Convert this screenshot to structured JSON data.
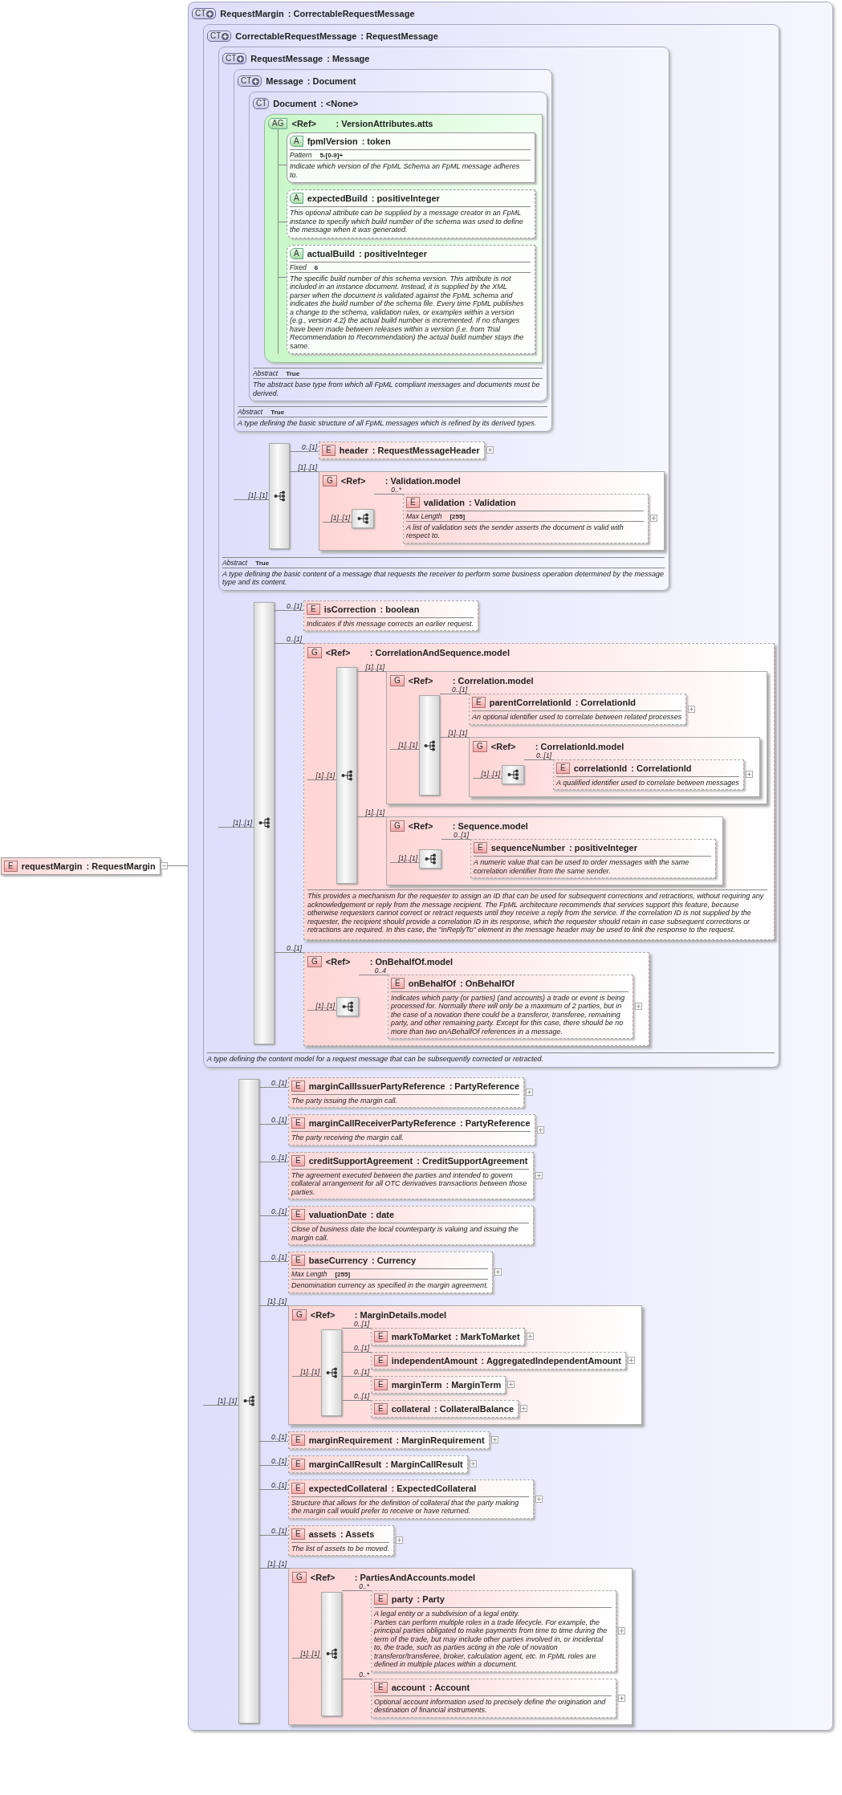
{
  "root_element": {
    "kind": "element",
    "badge": "E",
    "name": "requestMargin",
    "type": ": RequestMargin",
    "optional": false,
    "expanded": true
  },
  "type_tree": {
    "kind": "complex_type",
    "badge": "CT",
    "derived": true,
    "name": "RequestMargin",
    "type": ": CorrectableRequestMessage",
    "base": {
      "kind": "complex_type",
      "badge": "CT",
      "derived": true,
      "name": "CorrectableRequestMessage",
      "type": ": RequestMessage",
      "base": {
        "kind": "complex_type",
        "badge": "CT",
        "derived": true,
        "name": "RequestMessage",
        "type": ": Message",
        "base": {
          "kind": "complex_type",
          "badge": "CT",
          "derived": true,
          "name": "Message",
          "type": ": Document",
          "base": {
            "kind": "complex_type",
            "badge": "CT",
            "derived": false,
            "name": "Document",
            "type": ": <None>",
            "attributes": {
              "kind": "attribute_group",
              "badge": "AG",
              "name": "<Ref>",
              "type": ": VersionAttributes.atts",
              "items": [
                {
                  "kind": "attribute",
                  "badge": "A",
                  "name": "fpmlVersion",
                  "type": ": token",
                  "optional": false,
                  "facets": [
                    {
                      "label": "Pattern",
                      "value": "5-[0-9]+"
                    }
                  ],
                  "documentation": "Indicate which version of the FpML Schema an FpML message adheres to."
                },
                {
                  "kind": "attribute",
                  "badge": "A",
                  "name": "expectedBuild",
                  "type": ": positiveInteger",
                  "optional": true,
                  "documentation": "This optional attribute can be supplied by a message creator in an FpML instance to specify which build number of the schema was used to define the message when it was generated."
                },
                {
                  "kind": "attribute",
                  "badge": "A",
                  "name": "actualBuild",
                  "type": ": positiveInteger",
                  "optional": true,
                  "facets": [
                    {
                      "label": "Fixed",
                      "value": "6"
                    }
                  ],
                  "documentation": "The specific build number of this schema version. This attribute is not included in an instance document. Instead, it is supplied by the XML parser when the document is validated against the FpML schema and indicates the build number of the schema file. Every time FpML publishes a change to the schema, validation rules, or examples within a version (e.g., version 4.2) the actual build number is incremented. If no changes have been made between releases within a version (i.e. from Trial Recommendation to Recommendation) the actual build number stays the same."
                }
              ]
            },
            "facets": [
              {
                "label": "Abstract",
                "value": "True"
              }
            ],
            "documentation": "The abstract base type from which all FpML compliant messages and documents must be derived."
          },
          "facets": [
            {
              "label": "Abstract",
              "value": "True"
            }
          ],
          "documentation": "A type defining the basic structure of all FpML messages which is refined by its derived types."
        },
        "sequence": {
          "occurs": "[1]..[1]",
          "items": [
            {
              "kind": "element",
              "badge": "E",
              "name": "header",
              "type": ": RequestMessageHeader",
              "occurs": "0..[1]",
              "optional": true,
              "expandable": true
            },
            {
              "kind": "group",
              "badge": "G",
              "name": "<Ref>",
              "type": ": Validation.model",
              "occurs": "[1]..[1]",
              "optional": false,
              "sequence": {
                "occurs": "[1]..[1]",
                "items": [
                  {
                    "kind": "element",
                    "badge": "E",
                    "name": "validation",
                    "type": ": Validation",
                    "occurs": "0..*",
                    "optional": true,
                    "expandable": true,
                    "facets": [
                      {
                        "label": "Max Length",
                        "value": "[255]"
                      }
                    ],
                    "documentation": "A list of validation sets the sender asserts the document is valid with respect to."
                  }
                ]
              }
            }
          ]
        },
        "facets": [
          {
            "label": "Abstract",
            "value": "True"
          }
        ],
        "documentation": "A type defining the basic content of a message that requests the receiver to perform some business operation determined by the message type and its content."
      },
      "sequence": {
        "occurs": "[1]..[1]",
        "items": [
          {
            "kind": "element",
            "badge": "E",
            "name": "isCorrection",
            "type": ": boolean",
            "occurs": "0..[1]",
            "optional": true,
            "expandable": false,
            "documentation": "Indicates if this message corrects an earlier request."
          },
          {
            "kind": "group",
            "badge": "G",
            "name": "<Ref>",
            "type": ": CorrelationAndSequence.model",
            "occurs": "0..[1]",
            "optional": true,
            "sequence": {
              "occurs": "[1]..[1]",
              "items": [
                {
                  "kind": "group",
                  "badge": "G",
                  "name": "<Ref>",
                  "type": ": Correlation.model",
                  "occurs": "[1]..[1]",
                  "optional": false,
                  "sequence": {
                    "occurs": "[1]..[1]",
                    "items": [
                      {
                        "kind": "element",
                        "badge": "E",
                        "name": "parentCorrelationId",
                        "type": ": CorrelationId",
                        "occurs": "0..[1]",
                        "optional": true,
                        "expandable": true,
                        "documentation": "An optional identifier used to correlate between related processes"
                      },
                      {
                        "kind": "group",
                        "badge": "G",
                        "name": "<Ref>",
                        "type": ": CorrelationId.model",
                        "occurs": "[1]..[1]",
                        "optional": false,
                        "sequence": {
                          "occurs": "[1]..[1]",
                          "items": [
                            {
                              "kind": "element",
                              "badge": "E",
                              "name": "correlationId",
                              "type": ": CorrelationId",
                              "occurs": "0..[1]",
                              "optional": true,
                              "expandable": true,
                              "documentation": "A qualified identifier used to correlate between messages"
                            }
                          ]
                        }
                      }
                    ]
                  }
                },
                {
                  "kind": "group",
                  "badge": "G",
                  "name": "<Ref>",
                  "type": ": Sequence.model",
                  "occurs": "[1]..[1]",
                  "optional": false,
                  "sequence": {
                    "occurs": "[1]..[1]",
                    "items": [
                      {
                        "kind": "element",
                        "badge": "E",
                        "name": "sequenceNumber",
                        "type": ": positiveInteger",
                        "occurs": "0..[1]",
                        "optional": true,
                        "expandable": false,
                        "documentation": "A numeric value that can be used to order messages with the same correlation identifier from the same sender."
                      }
                    ]
                  }
                }
              ]
            },
            "documentation": "This provides a mechanism for the requester to assign an ID that can be used for subsequent corrections and retractions, without requiring any acknowledgement or reply from the message recipient. The FpML architecture recommends that services support this feature, because otherwise requesters cannot correct or retract requests until they receive a reply from the service. If the correlation ID is not supplied by the requester, the recipient should provide a correlation ID in its response, which the requester should retain in case subsequent corrections or retractions are required. In this case, the \"inReplyTo\" element in the message header may be used to link the response to the request."
          },
          {
            "kind": "group",
            "badge": "G",
            "name": "<Ref>",
            "type": ": OnBehalfOf.model",
            "occurs": "0..[1]",
            "optional": true,
            "sequence": {
              "occurs": "[1]..[1]",
              "items": [
                {
                  "kind": "element",
                  "badge": "E",
                  "name": "onBehalfOf",
                  "type": ": OnBehalfOf",
                  "occurs": "0..4",
                  "optional": true,
                  "expandable": true,
                  "documentation": "Indicates which party (or parties) (and accounts) a trade or event is being processed for. Normally there will only be a maximum of 2 parties, but in the case of a novation there could be a transferor, transferee, remaining party, and other remaining party. Except for this case, there should be no more than two onABehalfOf references in a message."
                }
              ]
            }
          }
        ]
      },
      "documentation": "A type defining the content model for a request message that can be subsequently corrected or retracted."
    },
    "sequence": {
      "occurs": "[1]..[1]",
      "items": [
        {
          "kind": "element",
          "badge": "E",
          "name": "marginCallIssuerPartyReference",
          "type": ": PartyReference",
          "occurs": "0..[1]",
          "optional": true,
          "expandable": true,
          "documentation": "The party issuing the margin call."
        },
        {
          "kind": "element",
          "badge": "E",
          "name": "marginCallReceiverPartyReference",
          "type": ": PartyReference",
          "occurs": "0..[1]",
          "optional": true,
          "expandable": true,
          "documentation": "The party receiving the margin call."
        },
        {
          "kind": "element",
          "badge": "E",
          "name": "creditSupportAgreement",
          "type": ": CreditSupportAgreement",
          "occurs": "0..[1]",
          "optional": true,
          "expandable": true,
          "documentation": "The agreement executed between the parties and intended to govern collateral arrangement for all OTC derivatives transactions between those parties."
        },
        {
          "kind": "element",
          "badge": "E",
          "name": "valuationDate",
          "type": ": date",
          "occurs": "0..[1]",
          "optional": true,
          "expandable": false,
          "documentation": "Close of business date the local counterparty is valuing and issuing the margin call."
        },
        {
          "kind": "element",
          "badge": "E",
          "name": "baseCurrency",
          "type": ": Currency",
          "occurs": "0..[1]",
          "optional": true,
          "expandable": true,
          "facets": [
            {
              "label": "Max Length",
              "value": "[255]"
            }
          ],
          "documentation": "Denomination currency as specified in the margin agreement."
        },
        {
          "kind": "group",
          "badge": "G",
          "name": "<Ref>",
          "type": ": MarginDetails.model",
          "occurs": "[1]..[1]",
          "optional": false,
          "sequence": {
            "occurs": "[1]..[1]",
            "items": [
              {
                "kind": "element",
                "badge": "E",
                "name": "markToMarket",
                "type": ": MarkToMarket",
                "occurs": "0..[1]",
                "optional": true,
                "expandable": true
              },
              {
                "kind": "element",
                "badge": "E",
                "name": "independentAmount",
                "type": ": AggregatedIndependentAmount",
                "occurs": "0..[1]",
                "optional": true,
                "expandable": true
              },
              {
                "kind": "element",
                "badge": "E",
                "name": "marginTerm",
                "type": ": MarginTerm",
                "occurs": "0..[1]",
                "optional": true,
                "expandable": true
              },
              {
                "kind": "element",
                "badge": "E",
                "name": "collateral",
                "type": ": CollateralBalance",
                "occurs": "0..[1]",
                "optional": true,
                "expandable": true
              }
            ]
          }
        },
        {
          "kind": "element",
          "badge": "E",
          "name": "marginRequirement",
          "type": ": MarginRequirement",
          "occurs": "0..[1]",
          "optional": true,
          "expandable": true
        },
        {
          "kind": "element",
          "badge": "E",
          "name": "marginCallResult",
          "type": ": MarginCallResult",
          "occurs": "0..[1]",
          "optional": true,
          "expandable": true
        },
        {
          "kind": "element",
          "badge": "E",
          "name": "expectedCollateral",
          "type": ": ExpectedCollateral",
          "occurs": "0..[1]",
          "optional": true,
          "expandable": true,
          "documentation": "Structure that allows for the definition of collateral that the party making the margin call would prefer to receive or have returned."
        },
        {
          "kind": "element",
          "badge": "E",
          "name": "assets",
          "type": ": Assets",
          "occurs": "0..[1]",
          "optional": true,
          "expandable": true,
          "documentation": "The list of assets to be moved."
        },
        {
          "kind": "group",
          "badge": "G",
          "name": "<Ref>",
          "type": ": PartiesAndAccounts.model",
          "occurs": "[1]..[1]",
          "optional": false,
          "sequence": {
            "occurs": "[1]..[1]",
            "items": [
              {
                "kind": "element",
                "badge": "E",
                "name": "party",
                "type": ": Party",
                "occurs": "0..*",
                "optional": true,
                "expandable": true,
                "documentation": "A legal entity or a subdivision of a legal entity.\nParties can perform multiple roles in a trade lifecycle. For example, the principal parties obligated to make payments from time to time during the term of the trade, but may include other parties involved in, or incidental to, the trade, such as parties acting in the role of novation transferor/transferee, broker, calculation agent, etc. In FpML roles are defined in multiple places within a document."
              },
              {
                "kind": "element",
                "badge": "E",
                "name": "account",
                "type": ": Account",
                "occurs": "0..*",
                "optional": true,
                "expandable": true,
                "documentation": "Optional account information used to precisely define the origination and destination of financial instruments."
              }
            ]
          }
        }
      ]
    }
  }
}
